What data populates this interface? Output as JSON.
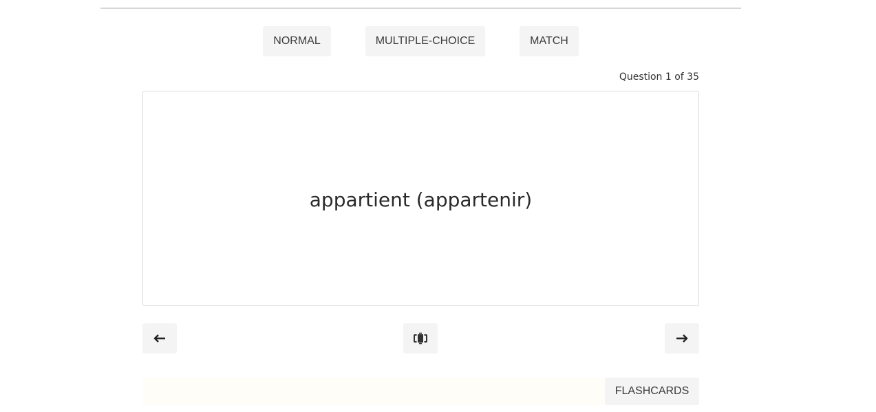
{
  "modes": {
    "normal_label": "NORMAL",
    "multiple_choice_label": "MULTIPLE-CHOICE",
    "match_label": "MATCH"
  },
  "quiz": {
    "counter": "Question 1 of 35",
    "current_term": "appartient (appartenir)"
  },
  "navigation": {
    "prev_icon": "arrow-left-icon",
    "flip_icon": "flip-card-icon",
    "next_icon": "arrow-right-icon"
  },
  "footer": {
    "flashcards_label": "FLASHCARDS"
  },
  "colors": {
    "button_bg": "#f4f4f4",
    "card_border": "#dcdcdc",
    "footer_bg": "#fffdf7",
    "text": "#212529"
  }
}
